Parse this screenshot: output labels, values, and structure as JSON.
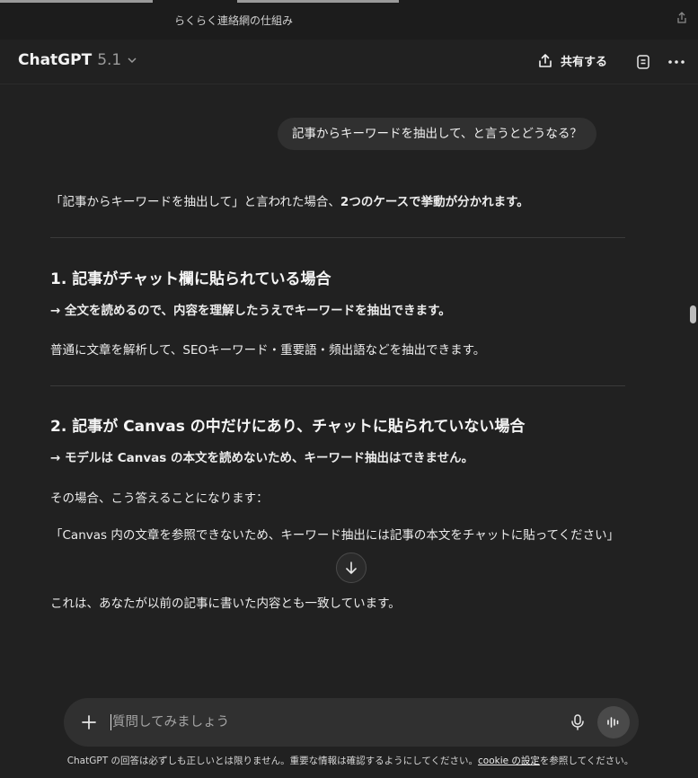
{
  "window": {
    "title": "らくらく連絡網の仕組み"
  },
  "header": {
    "model_name": "ChatGPT",
    "model_version": "5.1",
    "share_label": "共有する"
  },
  "conversation": {
    "user_message": "記事からキーワードを抽出して、と言うとどうなる？",
    "assistant": {
      "intro_prefix": "「記事からキーワードを抽出して」と言われた場合、",
      "intro_bold": "2つのケースで挙動が分かれます。",
      "section1": {
        "heading": "1. 記事がチャット欄に貼られている場合",
        "arrow_line": "→ 全文を読めるので、内容を理解したうえでキーワードを抽出できます。",
        "body": "普通に文章を解析して、SEOキーワード・重要語・頻出語などを抽出できます。"
      },
      "section2": {
        "heading": "2. 記事が Canvas の中だけにあり、チャットに貼られていない場合",
        "arrow_line": "→ モデルは Canvas の本文を読めないため、キーワード抽出はできません。",
        "body": "その場合、こう答えることになります：",
        "quote": "「Canvas 内の文章を参照できないため、キーワード抽出には記事の本文をチャットに貼ってください」",
        "closing": "これは、あなたが以前の記事に書いた内容とも一致しています。"
      }
    }
  },
  "composer": {
    "placeholder": "質問してみましょう"
  },
  "footer": {
    "text_before": "ChatGPT の回答は必ずしも正しいとは限りません。重要な情報は確認するようにしてください。",
    "link": "cookie の設定",
    "text_after": "を参照してください。"
  },
  "icons": {
    "share": "share-icon",
    "chevron": "chevron-down-icon",
    "doc": "document-icon",
    "more": "more-icon",
    "scroll": "arrow-down-icon",
    "plus": "plus-icon",
    "mic": "microphone-icon",
    "voice": "voice-mode-icon"
  }
}
